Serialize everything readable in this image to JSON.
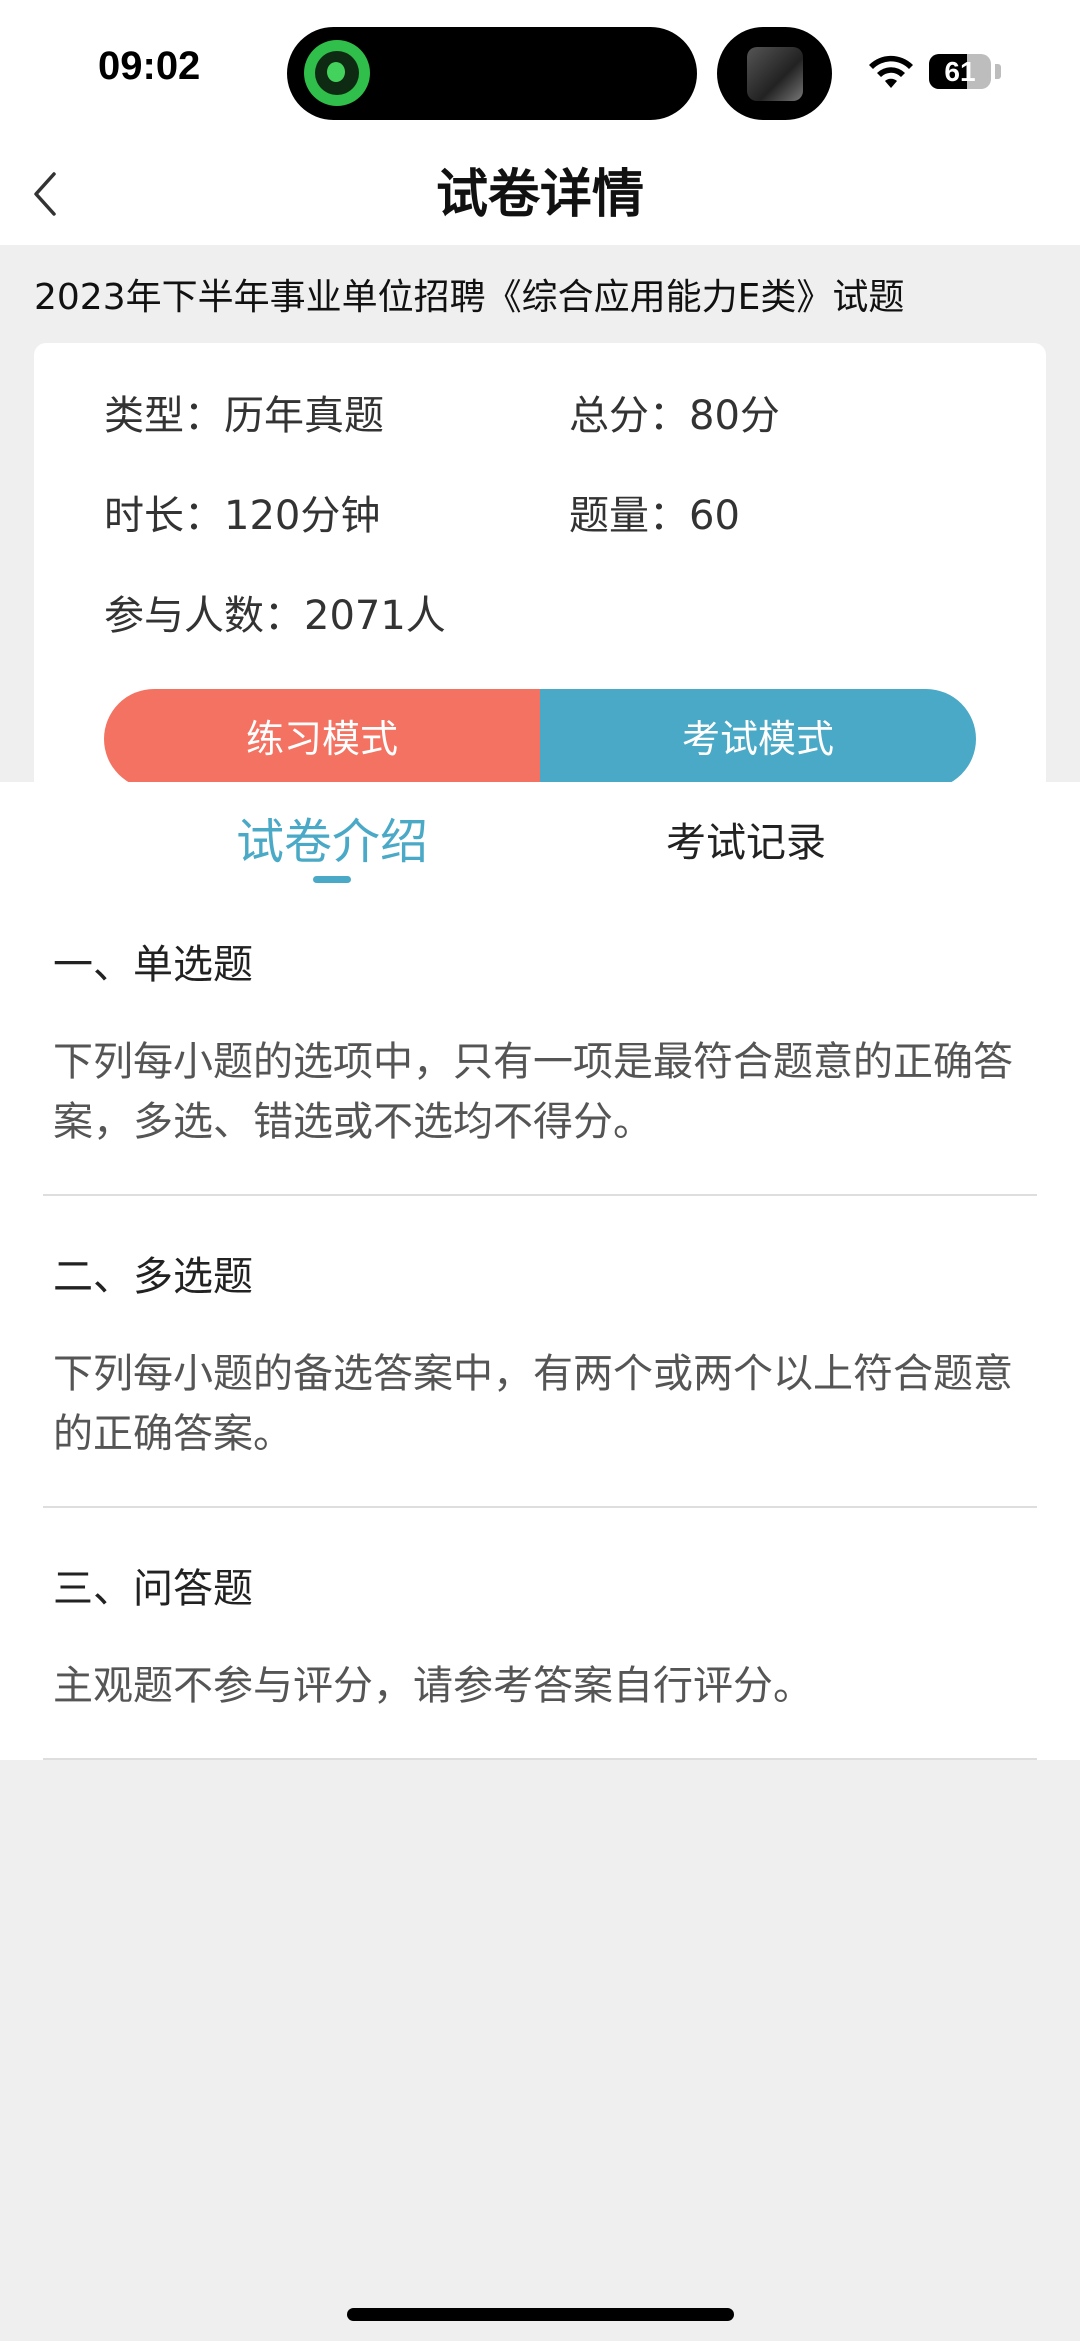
{
  "status_bar": {
    "time": "09:02",
    "battery_level": "61",
    "battery_fraction": 0.61,
    "wifi_icon": "wifi-icon"
  },
  "nav": {
    "back_icon": "chevron-left-icon",
    "title": "试卷详情"
  },
  "paper": {
    "title": "2023年下半年事业单位招聘《综合应用能力E类》试题"
  },
  "info": {
    "type": "类型：历年真题",
    "total_score": "总分：80分",
    "duration": "时长：120分钟",
    "question_count": "题量：60",
    "participants": "参与人数：2071人"
  },
  "modes": {
    "practice_label": "练习模式",
    "exam_label": "考试模式"
  },
  "tabs": {
    "intro_label": "试卷介绍",
    "records_label": "考试记录"
  },
  "sections": [
    {
      "heading": "一、单选题",
      "description": "下列每小题的选项中，只有一项是最符合题意的正确答案，多选、错选或不选均不得分。"
    },
    {
      "heading": "二、多选题",
      "description": "下列每小题的备选答案中，有两个或两个以上符合题意的正确答案。"
    },
    {
      "heading": "三、问答题",
      "description": "主观题不参与评分，请参考答案自行评分。"
    }
  ],
  "colors": {
    "accent": "#4aa9c6",
    "practice": "#f47262",
    "background": "#efefef"
  }
}
